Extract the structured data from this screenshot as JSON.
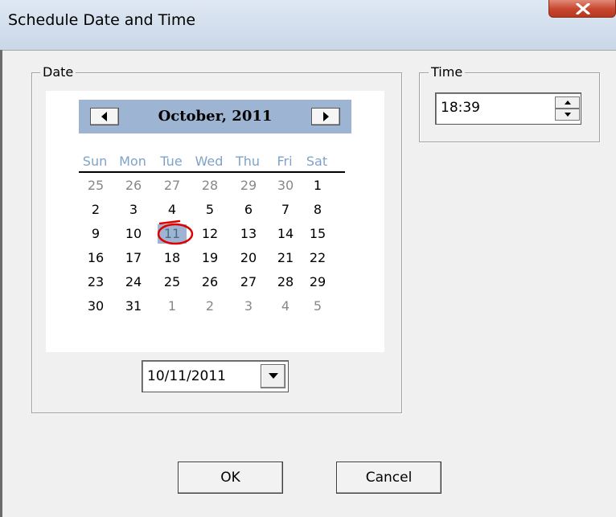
{
  "window": {
    "title": "Schedule Date and Time"
  },
  "date_group": {
    "label": "Date",
    "calendar": {
      "month_label": "October, 2011",
      "weekdays": [
        "Sun",
        "Mon",
        "Tue",
        "Wed",
        "Thu",
        "Fri",
        "Sat"
      ],
      "weeks": [
        [
          "25",
          "26",
          "27",
          "28",
          "29",
          "30",
          "1"
        ],
        [
          "2",
          "3",
          "4",
          "5",
          "6",
          "7",
          "8"
        ],
        [
          "9",
          "10",
          "11",
          "12",
          "13",
          "14",
          "15"
        ],
        [
          "16",
          "17",
          "18",
          "19",
          "20",
          "21",
          "22"
        ],
        [
          "23",
          "24",
          "25",
          "26",
          "27",
          "28",
          "29"
        ],
        [
          "30",
          "31",
          "1",
          "2",
          "3",
          "4",
          "5"
        ]
      ],
      "selected_day": "11",
      "selected_color": "#9db5d2",
      "highlight_color": "#e00000"
    },
    "date_value": "10/11/2011"
  },
  "time_group": {
    "label": "Time",
    "time_value": "18:39"
  },
  "buttons": {
    "ok": "OK",
    "cancel": "Cancel"
  },
  "icons": {
    "close": "close-icon",
    "prev": "chevron-left-icon",
    "next": "chevron-right-icon",
    "dropdown": "chevron-down-icon",
    "spin_up": "spin-up-icon",
    "spin_down": "spin-down-icon"
  }
}
